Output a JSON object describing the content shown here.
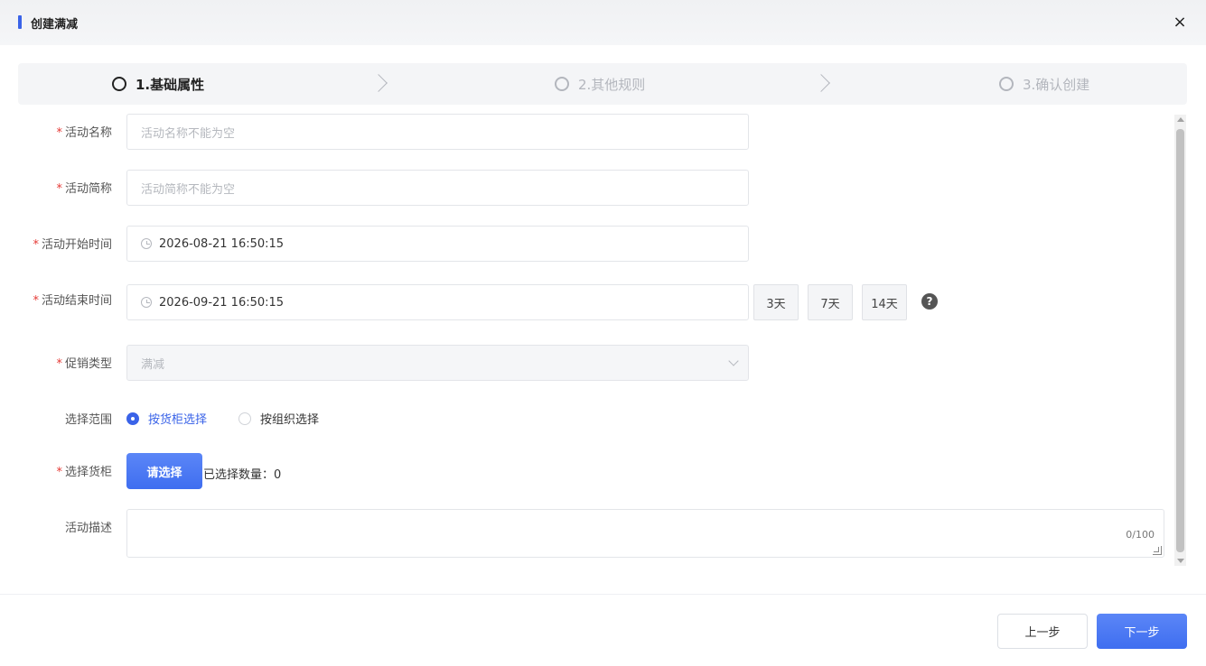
{
  "header": {
    "title": "创建满减",
    "close_glyph": "×"
  },
  "steps": [
    {
      "label": "1.基础属性",
      "state": "active"
    },
    {
      "label": "2.其他规则",
      "state": "inactive"
    },
    {
      "label": "3.确认创建",
      "state": "inactive"
    }
  ],
  "form": {
    "required_mark": "*",
    "activity_name": {
      "label": "活动名称",
      "placeholder": "活动名称不能为空"
    },
    "activity_short": {
      "label": "活动简称",
      "placeholder": "活动简称不能为空"
    },
    "start_time": {
      "label": "活动开始时间",
      "value": "2026-08-21 16:50:15"
    },
    "end_time": {
      "label": "活动结束时间",
      "value": "2026-09-21 16:50:15"
    },
    "quick_ranges": [
      "3天",
      "7天",
      "14天"
    ],
    "help_glyph": "?",
    "promo_type": {
      "label": "促销类型",
      "value": "满减"
    },
    "scope": {
      "label": "选择范围",
      "options": [
        "按货柜选择",
        "按组织选择"
      ],
      "selected": "按货柜选择"
    },
    "cabinet": {
      "label": "选择货柜",
      "button": "请选择",
      "count_text": "已选择数量：0"
    },
    "description": {
      "label": "活动描述",
      "counter": "0/100"
    }
  },
  "footer": {
    "prev": "上一步",
    "next": "下一步"
  },
  "colors": {
    "accent": "#3a63e8",
    "required": "#e53935"
  }
}
